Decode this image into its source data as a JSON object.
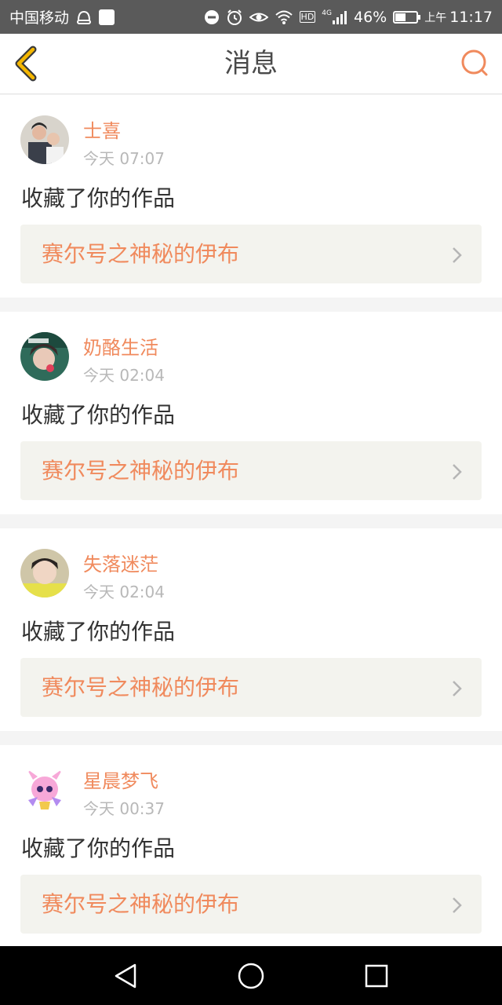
{
  "status_bar": {
    "carrier": "中国移动",
    "network": "4G",
    "hd": "HD",
    "battery_percent": "46%",
    "battery_level": 0.46,
    "ampm": "上午",
    "time": "11:17"
  },
  "header": {
    "title": "消息",
    "back_icon": "chevron-left-icon",
    "search_icon": "search-icon"
  },
  "colors": {
    "accent": "#f08a5d",
    "icon_yellow": "#f5b700",
    "card_link_bg": "#f3f3ee",
    "status_bar_bg": "#5a5a5a"
  },
  "messages": [
    {
      "user": "士喜",
      "time": "今天 07:07",
      "action": "收藏了你的作品",
      "work": "赛尔号之神秘的伊布",
      "avatar": "avatar-photo-couple"
    },
    {
      "user": "奶酪生活",
      "time": "今天 02:04",
      "action": "收藏了你的作品",
      "work": "赛尔号之神秘的伊布",
      "avatar": "avatar-photo-girl"
    },
    {
      "user": "失落迷茫",
      "time": "今天 02:04",
      "action": "收藏了你的作品",
      "work": "赛尔号之神秘的伊布",
      "avatar": "avatar-photo-boy"
    },
    {
      "user": "星晨梦飞",
      "time": "今天 00:37",
      "action": "收藏了你的作品",
      "work": "赛尔号之神秘的伊布",
      "avatar": "avatar-cartoon-pink"
    }
  ],
  "nav_bar": {
    "back": "triangle-back-icon",
    "home": "circle-home-icon",
    "recent": "square-recent-icon"
  }
}
